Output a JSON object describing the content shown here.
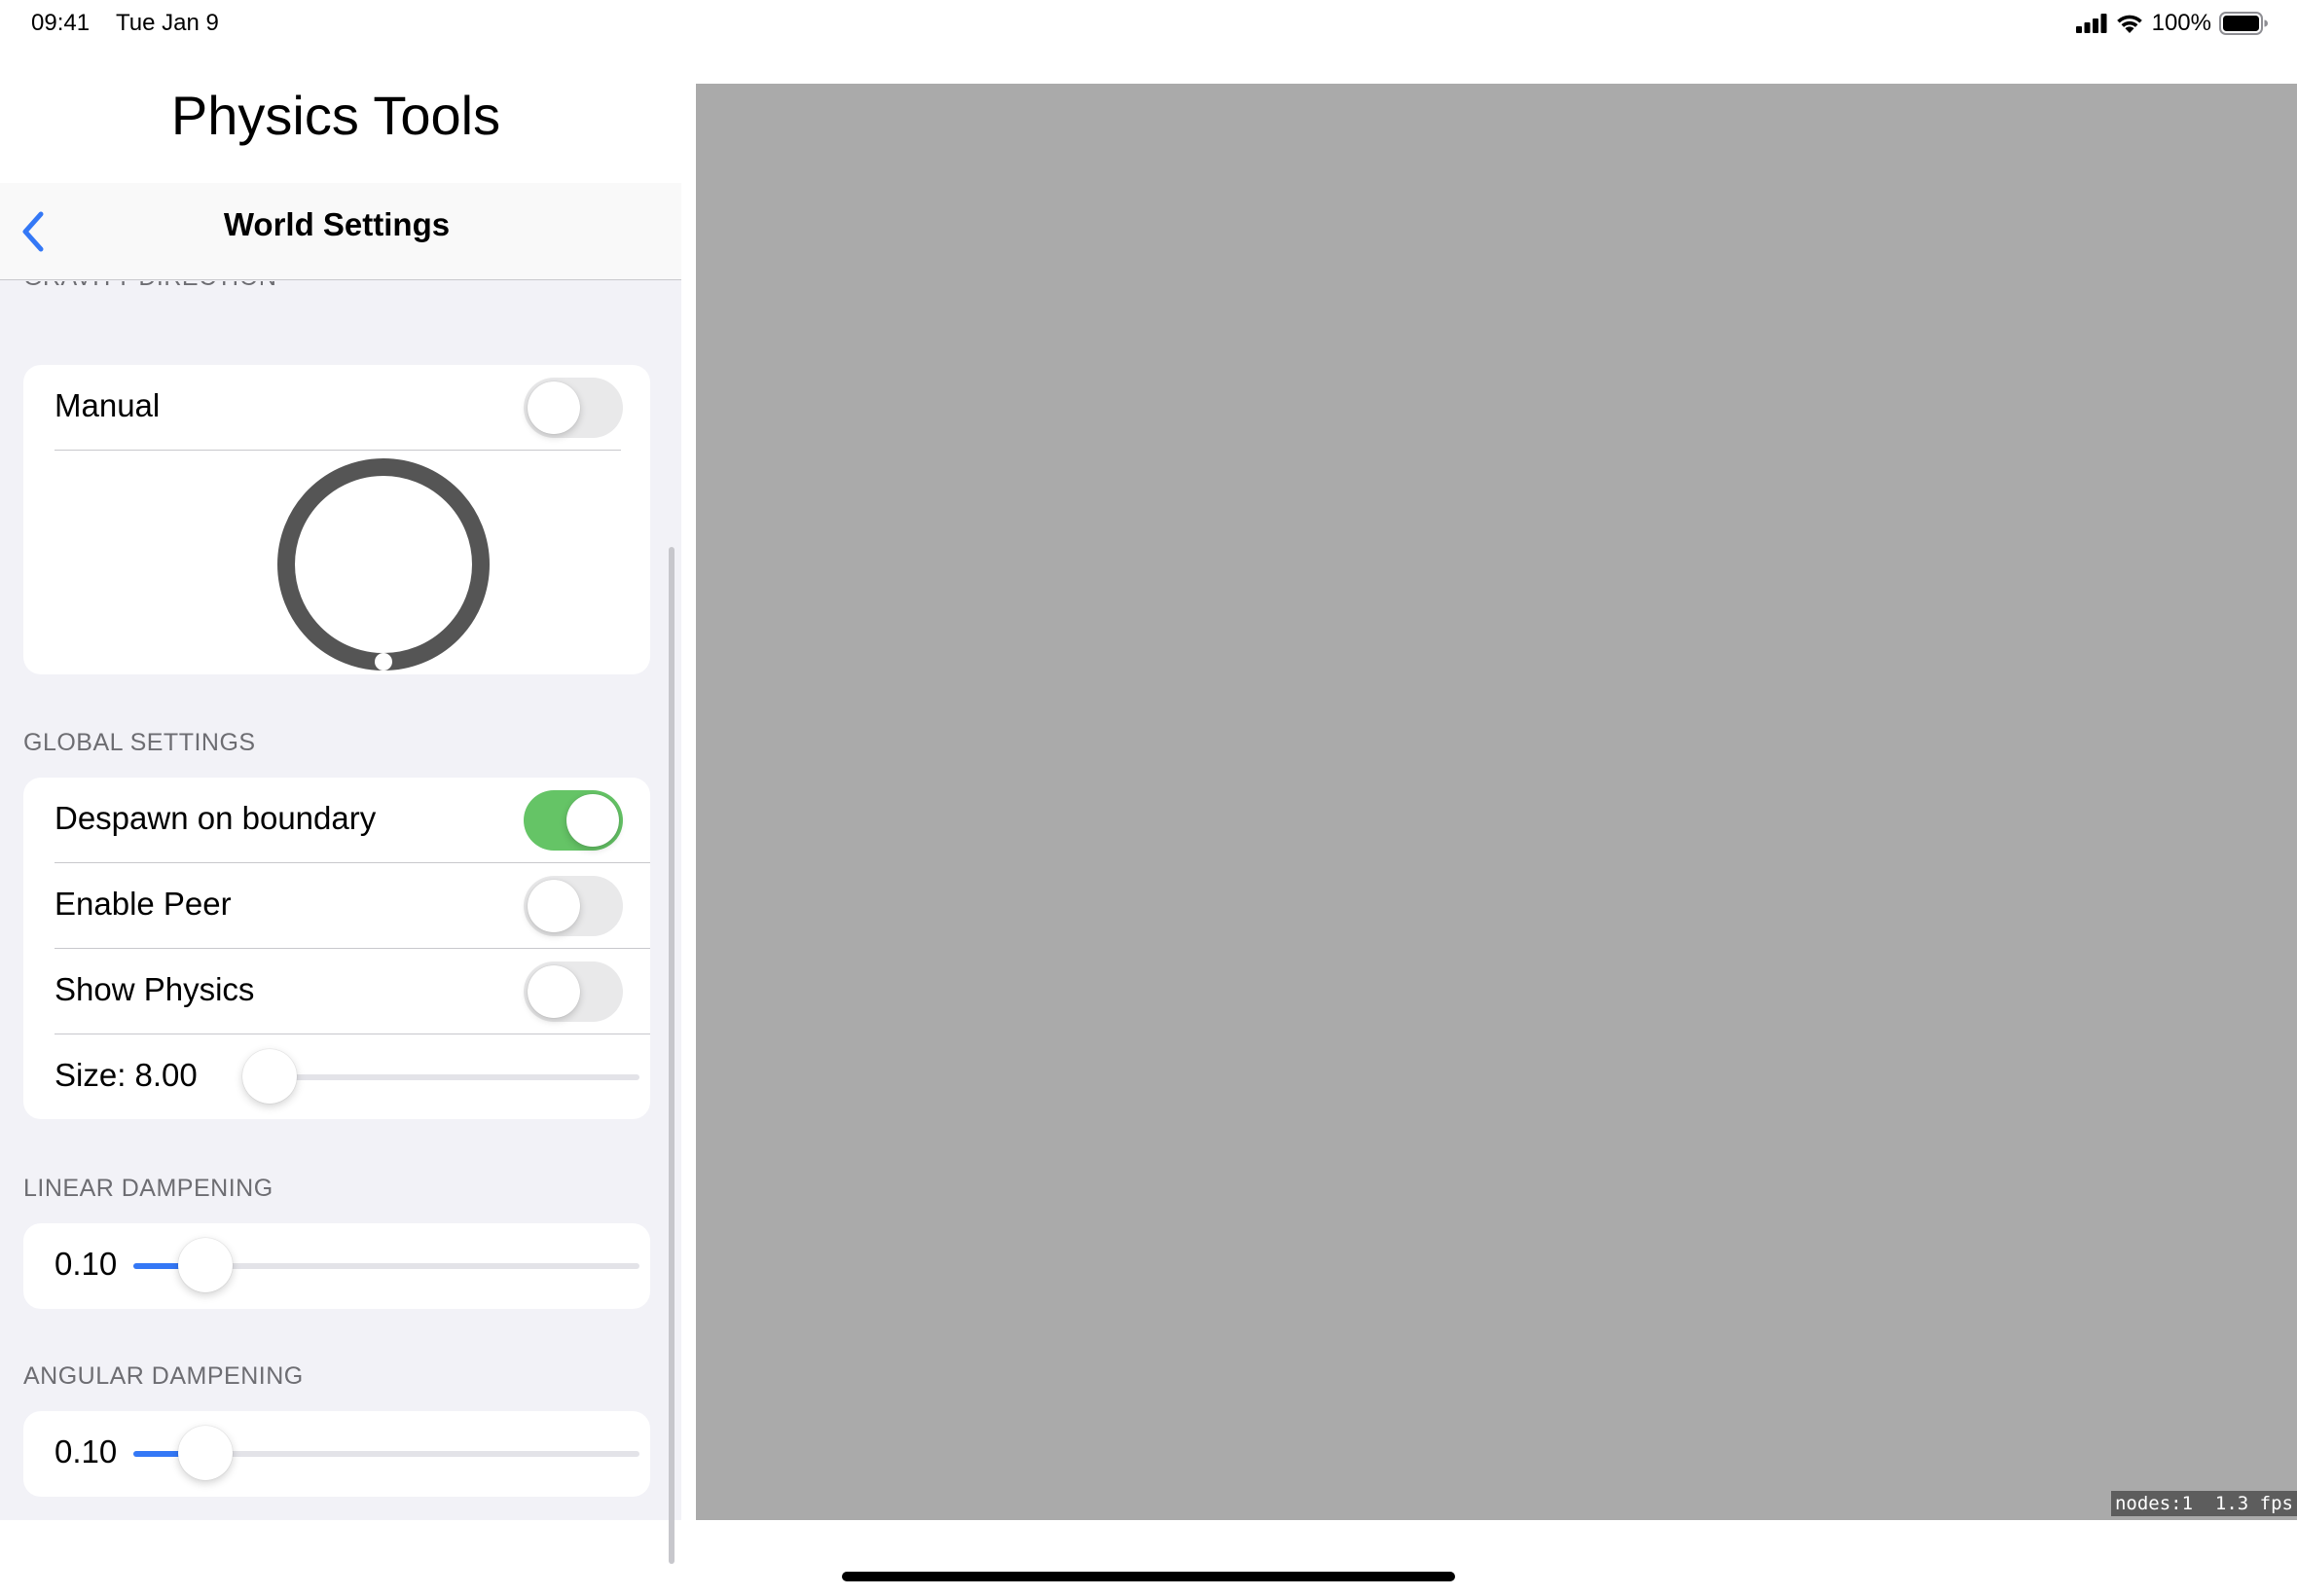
{
  "status_bar": {
    "time": "09:41",
    "date": "Tue Jan 9",
    "battery_percent": "100%",
    "icons": [
      "cellular-signal-icon",
      "wifi-icon",
      "battery-icon"
    ]
  },
  "sidebar": {
    "app_title": "Physics Tools",
    "nav_title": "World Settings",
    "back_icon": "chevron-left-icon",
    "accent_color": "#3478f6",
    "sections": {
      "gravity": {
        "header": "GRAVITY DIRECTION",
        "manual_label": "Manual",
        "manual_on": false
      },
      "global": {
        "header": "GLOBAL SETTINGS",
        "despawn_label": "Despawn on boundary",
        "despawn_on": true,
        "enable_peer_label": "Enable Peer",
        "enable_peer_on": false,
        "show_physics_label": "Show Physics",
        "show_physics_on": false,
        "size_label": "Size: 8.00",
        "size_fraction": 0.0
      },
      "linear": {
        "header": "LINEAR DAMPENING",
        "value_label": "0.10",
        "fraction": 0.1
      },
      "angular": {
        "header": "ANGULAR DAMPENING",
        "value_label": "0.10",
        "fraction": 0.1
      }
    },
    "toggle_on_color": "#65c466"
  },
  "scene": {
    "background_color": "#aaaaaa",
    "stats": "nodes:1  1.3 fps"
  }
}
